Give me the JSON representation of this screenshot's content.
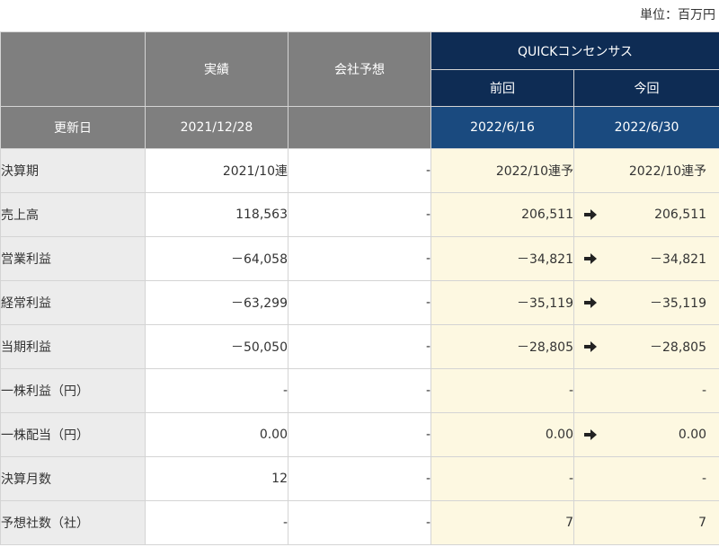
{
  "unit_label": "単位：百万円",
  "header": {
    "actual": "実績",
    "company_forecast": "会社予想",
    "consensus": "QUICKコンセンサス",
    "previous": "前回",
    "current": "今回",
    "updated_label": "更新日",
    "actual_date": "2021/12/28",
    "company_date": "",
    "previous_date": "2022/6/16",
    "current_date": "2022/6/30"
  },
  "rows": [
    {
      "label": "決算期",
      "actual": "2021/10連",
      "company": "-",
      "previous": "2022/10連予",
      "current": "2022/10連予",
      "arrow": false
    },
    {
      "label": "売上高",
      "actual": "118,563",
      "company": "-",
      "previous": "206,511",
      "current": "206,511",
      "arrow": true
    },
    {
      "label": "営業利益",
      "actual": "－64,058",
      "company": "-",
      "previous": "－34,821",
      "current": "－34,821",
      "arrow": true
    },
    {
      "label": "経常利益",
      "actual": "－63,299",
      "company": "-",
      "previous": "－35,119",
      "current": "－35,119",
      "arrow": true
    },
    {
      "label": "当期利益",
      "actual": "－50,050",
      "company": "-",
      "previous": "－28,805",
      "current": "－28,805",
      "arrow": true
    },
    {
      "label": "一株利益（円）",
      "actual": "-",
      "company": "-",
      "previous": "-",
      "current": "-",
      "arrow": false
    },
    {
      "label": "一株配当（円）",
      "actual": "0.00",
      "company": "-",
      "previous": "0.00",
      "current": "0.00",
      "arrow": true
    },
    {
      "label": "決算月数",
      "actual": "12",
      "company": "-",
      "previous": "-",
      "current": "-",
      "arrow": false
    },
    {
      "label": "予想社数（社）",
      "actual": "-",
      "company": "-",
      "previous": "7",
      "current": "7",
      "arrow": false
    }
  ],
  "colors": {
    "header_gray": "#7f7f7f",
    "header_navy": "#0e2c54",
    "header_blue": "#1a4a7f",
    "consensus_bg": "#fdf8e1",
    "label_bg": "#ececec"
  },
  "icons": {
    "unchanged": "arrow-right-icon"
  }
}
